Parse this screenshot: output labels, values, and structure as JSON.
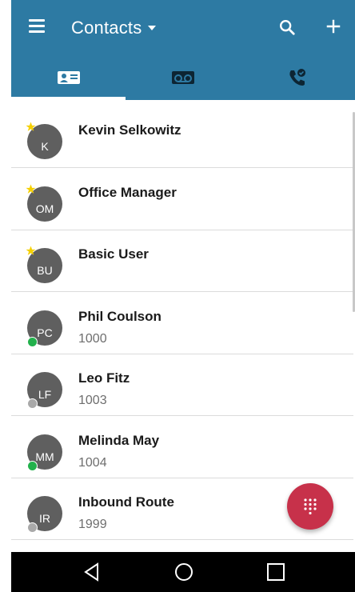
{
  "app_bar": {
    "title": "Contacts",
    "color": "#2d7aa3",
    "icons": [
      "menu-icon",
      "chevron-down-icon",
      "search-icon",
      "add-icon"
    ]
  },
  "tabs": [
    {
      "icon": "contact-card-icon",
      "selected": true
    },
    {
      "icon": "voicemail-icon",
      "selected": false
    },
    {
      "icon": "call-history-icon",
      "selected": false
    }
  ],
  "contacts": [
    {
      "initials": "K",
      "name": "Kevin Selkowitz",
      "ext": "",
      "favorite": true,
      "presence": "none"
    },
    {
      "initials": "OM",
      "name": "Office Manager",
      "ext": "",
      "favorite": true,
      "presence": "none"
    },
    {
      "initials": "BU",
      "name": "Basic User",
      "ext": "",
      "favorite": true,
      "presence": "none"
    },
    {
      "initials": "PC",
      "name": "Phil Coulson",
      "ext": "1000",
      "favorite": false,
      "presence": "online"
    },
    {
      "initials": "LF",
      "name": "Leo Fitz",
      "ext": "1003",
      "favorite": false,
      "presence": "offline"
    },
    {
      "initials": "MM",
      "name": "Melinda May",
      "ext": "1004",
      "favorite": false,
      "presence": "online"
    },
    {
      "initials": "IR",
      "name": "Inbound Route",
      "ext": "1999",
      "favorite": false,
      "presence": "offline"
    }
  ],
  "colors": {
    "star": "#f5d000",
    "presence_online": "#22b14c",
    "presence_offline": "#a9a9a9",
    "fab": "#c7314a"
  },
  "fab": {
    "icon": "dialpad-icon"
  },
  "nav": {
    "icons": [
      "back-icon",
      "home-icon",
      "recents-icon"
    ]
  }
}
